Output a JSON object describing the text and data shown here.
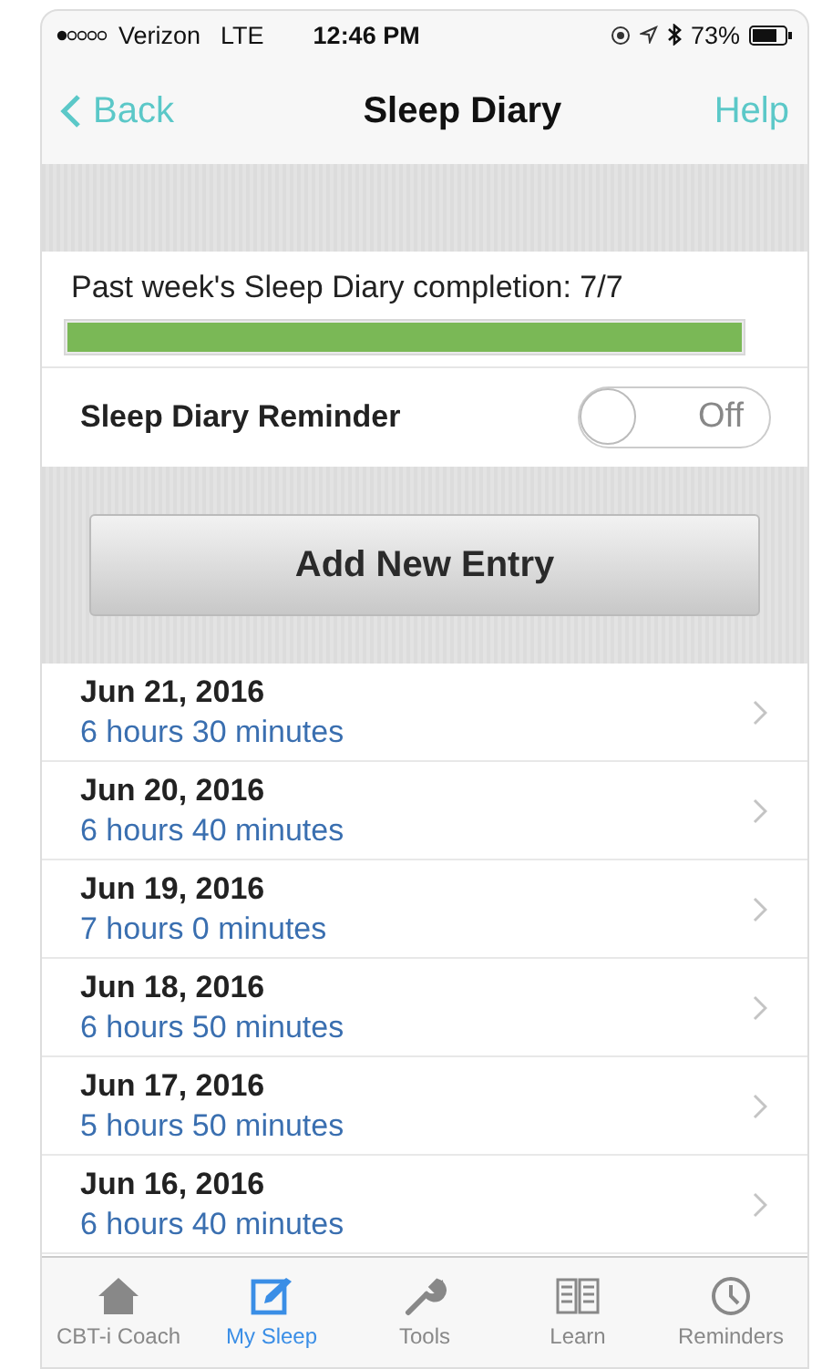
{
  "status_bar": {
    "carrier": "Verizon",
    "network": "LTE",
    "time": "12:46 PM",
    "battery": "73%"
  },
  "nav": {
    "back": "Back",
    "title": "Sleep Diary",
    "help": "Help"
  },
  "completion": {
    "text": "Past week's Sleep Diary completion: 7/7",
    "level": 1
  },
  "reminder": {
    "label": "Sleep Diary Reminder",
    "on": false,
    "state_text": "Off"
  },
  "add_button": "Add New Entry",
  "entries": [
    {
      "date": "Jun 21, 2016",
      "duration": "6 hours 30 minutes"
    },
    {
      "date": "Jun 20, 2016",
      "duration": "6 hours 40 minutes"
    },
    {
      "date": "Jun 19, 2016",
      "duration": "7 hours 0 minutes"
    },
    {
      "date": "Jun 18, 2016",
      "duration": "6 hours 50 minutes"
    },
    {
      "date": "Jun 17, 2016",
      "duration": "5 hours 50 minutes"
    },
    {
      "date": "Jun 16, 2016",
      "duration": "6 hours 40 minutes"
    }
  ],
  "tabs": [
    {
      "kind": "home",
      "label": "CBT-i Coach",
      "selected": false
    },
    {
      "kind": "edit",
      "label": "My Sleep",
      "selected": true
    },
    {
      "kind": "wrench",
      "label": "Tools",
      "selected": false
    },
    {
      "kind": "book",
      "label": "Learn",
      "selected": false
    },
    {
      "kind": "clock",
      "label": "Reminders",
      "selected": false
    }
  ]
}
